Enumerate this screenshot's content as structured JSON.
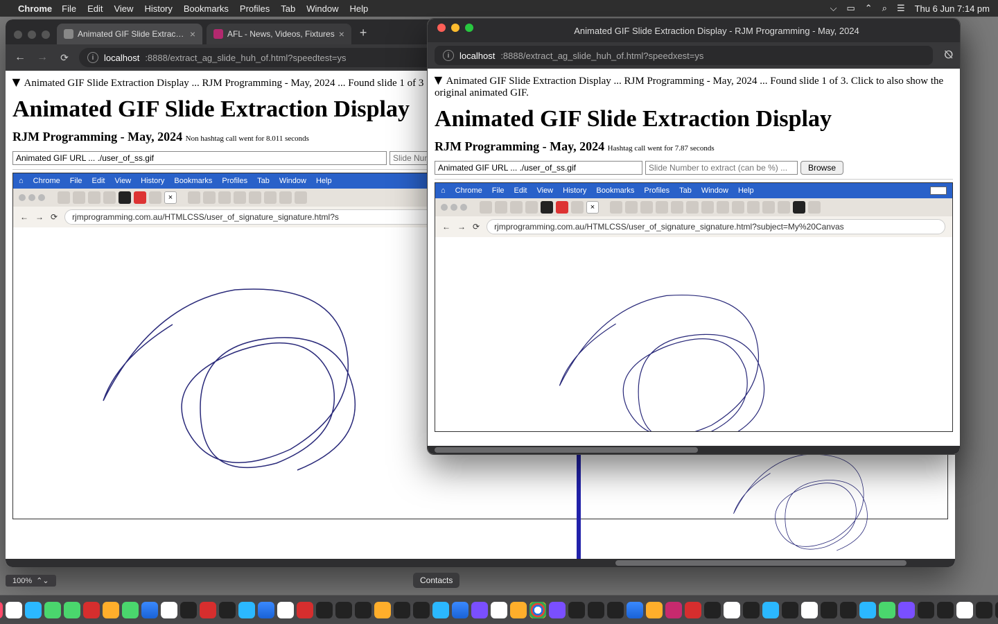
{
  "menubar": {
    "app": "Chrome",
    "items": [
      "File",
      "Edit",
      "View",
      "History",
      "Bookmarks",
      "Profiles",
      "Tab",
      "Window",
      "Help"
    ],
    "clock": "Thu 6 Jun  7:14 pm"
  },
  "bg_window": {
    "tabs": [
      {
        "title": "Animated GIF Slide Extraction"
      },
      {
        "title": "AFL - News, Videos, Fixtures"
      }
    ],
    "url_host": "localhost",
    "url_path": ":8888/extract_ag_slide_huh_of.html?speedtest=ys",
    "details": "Animated GIF Slide Extraction Display ... RJM Programming - May, 2024 ... Found slide 1 of 3",
    "h1": "Animated GIF Slide Extraction Display",
    "subline": "RJM Programming - May, 2024",
    "subnote": "Non hashtag call went for 8.011 seconds",
    "url_input": "Animated GIF URL ... ./user_of_ss.gif",
    "slide_input_label": "Slide Numb",
    "inner_url": "rjmprogramming.com.au/HTMLCSS/user_of_signature_signature.html?s",
    "inner_menu": [
      "Chrome",
      "File",
      "Edit",
      "View",
      "History",
      "Bookmarks",
      "Profiles",
      "Tab",
      "Window",
      "Help"
    ]
  },
  "fg_window": {
    "title": "Animated GIF Slide Extraction Display - RJM Programming - May, 2024",
    "url_host": "localhost",
    "url_path": ":8888/extract_ag_slide_huh_of.html?speedxest=ys",
    "details": "Animated GIF Slide Extraction Display ... RJM Programming - May, 2024 ... Found slide 1 of 3. Click to also show the original animated GIF.",
    "h1": "Animated GIF Slide Extraction Display",
    "subline": "RJM Programming - May, 2024",
    "subnote": "Hashtag call went for 7.87 seconds",
    "url_input": "Animated GIF URL ... ./user_of_ss.gif",
    "slide_input_placeholder": "Slide Number to extract (can be %) ...",
    "browse_btn": "Browse",
    "inner_url": "rjmprogramming.com.au/HTMLCSS/user_of_signature_signature.html?subject=My%20Canvas",
    "inner_menu": [
      "Chrome",
      "File",
      "Edit",
      "View",
      "History",
      "Bookmarks",
      "Profiles",
      "Tab",
      "Window",
      "Help"
    ]
  },
  "tooltip": "Contacts",
  "zoom": "100%"
}
